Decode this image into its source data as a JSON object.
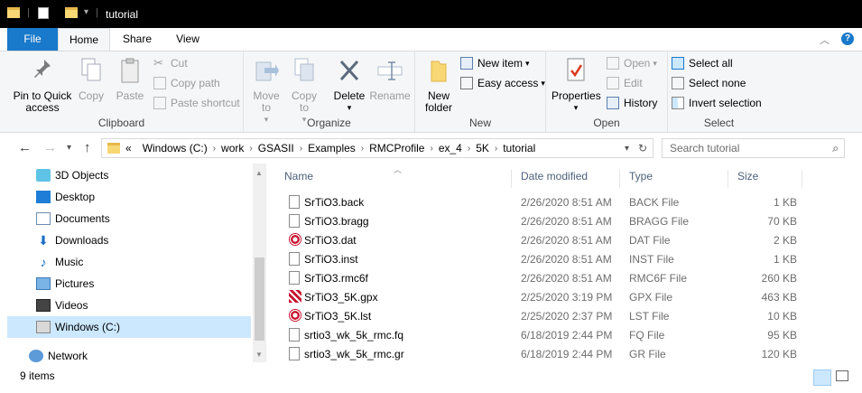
{
  "window": {
    "title": "tutorial"
  },
  "tabs": {
    "file": "File",
    "home": "Home",
    "share": "Share",
    "view": "View"
  },
  "ribbon": {
    "clipboard": {
      "label": "Clipboard",
      "pin": "Pin to Quick access",
      "copy": "Copy",
      "paste": "Paste",
      "cut": "Cut",
      "copy_path": "Copy path",
      "paste_shortcut": "Paste shortcut"
    },
    "organize": {
      "label": "Organize",
      "move_to": "Move to",
      "copy_to": "Copy to",
      "delete": "Delete",
      "rename": "Rename"
    },
    "new": {
      "label": "New",
      "new_folder": "New folder",
      "new_item": "New item",
      "easy_access": "Easy access"
    },
    "open": {
      "label": "Open",
      "properties": "Properties",
      "open": "Open",
      "edit": "Edit",
      "history": "History"
    },
    "select": {
      "label": "Select",
      "select_all": "Select all",
      "select_none": "Select none",
      "invert": "Invert selection"
    }
  },
  "address": {
    "overflow": "«",
    "crumbs": [
      "Windows (C:)",
      "work",
      "GSASII",
      "Examples",
      "RMCProfile",
      "ex_4",
      "5K",
      "tutorial"
    ]
  },
  "search": {
    "placeholder": "Search tutorial"
  },
  "nav": {
    "items": [
      {
        "label": "3D Objects",
        "icon": "3d-objects-icon"
      },
      {
        "label": "Desktop",
        "icon": "desktop-icon"
      },
      {
        "label": "Documents",
        "icon": "documents-icon"
      },
      {
        "label": "Downloads",
        "icon": "downloads-icon"
      },
      {
        "label": "Music",
        "icon": "music-icon"
      },
      {
        "label": "Pictures",
        "icon": "pictures-icon"
      },
      {
        "label": "Videos",
        "icon": "videos-icon"
      },
      {
        "label": "Windows (C:)",
        "icon": "drive-icon"
      },
      {
        "label": "Network",
        "icon": "network-icon"
      }
    ]
  },
  "columns": {
    "name": "Name",
    "date": "Date modified",
    "type": "Type",
    "size": "Size"
  },
  "files": [
    {
      "name": "SrTiO3.back",
      "date": "2/26/2020 8:51 AM",
      "type": "BACK File",
      "size": "1 KB",
      "icon": "document-icon"
    },
    {
      "name": "SrTiO3.bragg",
      "date": "2/26/2020 8:51 AM",
      "type": "BRAGG File",
      "size": "70 KB",
      "icon": "document-icon"
    },
    {
      "name": "SrTiO3.dat",
      "date": "2/26/2020 8:51 AM",
      "type": "DAT File",
      "size": "2 KB",
      "icon": "app-file-icon"
    },
    {
      "name": "SrTiO3.inst",
      "date": "2/26/2020 8:51 AM",
      "type": "INST File",
      "size": "1 KB",
      "icon": "document-icon"
    },
    {
      "name": "SrTiO3.rmc6f",
      "date": "2/26/2020 8:51 AM",
      "type": "RMC6F File",
      "size": "260 KB",
      "icon": "document-icon"
    },
    {
      "name": "SrTiO3_5K.gpx",
      "date": "2/25/2020 3:19 PM",
      "type": "GPX File",
      "size": "463 KB",
      "icon": "gsas-file-icon"
    },
    {
      "name": "SrTiO3_5K.lst",
      "date": "2/25/2020 2:37 PM",
      "type": "LST File",
      "size": "10 KB",
      "icon": "app-file-icon"
    },
    {
      "name": "srtio3_wk_5k_rmc.fq",
      "date": "6/18/2019 2:44 PM",
      "type": "FQ File",
      "size": "95 KB",
      "icon": "document-icon"
    },
    {
      "name": "srtio3_wk_5k_rmc.gr",
      "date": "6/18/2019 2:44 PM",
      "type": "GR File",
      "size": "120 KB",
      "icon": "document-icon"
    }
  ],
  "status": {
    "count": "9 items"
  },
  "colors": {
    "accent": "#1979ca",
    "selection": "#cce8ff",
    "ribbon_bg": "#f5f6f7"
  }
}
